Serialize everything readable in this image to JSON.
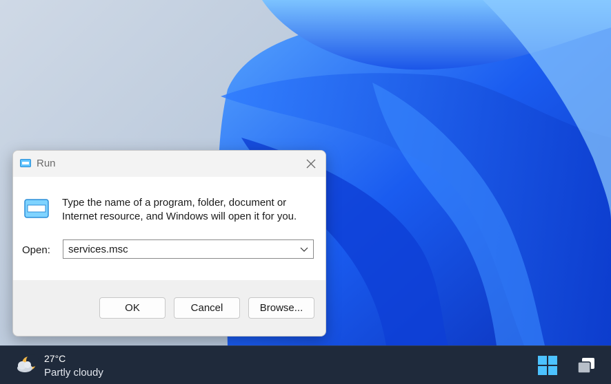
{
  "dialog": {
    "title": "Run",
    "instruction": "Type the name of a program, folder, document or Internet resource, and Windows will open it for you.",
    "open_label": "Open:",
    "open_value": "services.msc",
    "buttons": {
      "ok": "OK",
      "cancel": "Cancel",
      "browse": "Browse..."
    }
  },
  "taskbar": {
    "weather": {
      "temperature": "27°C",
      "condition": "Partly cloudy",
      "icon": "partly-cloudy-moon-icon"
    },
    "icons": {
      "start": "windows-logo-icon",
      "task_view": "task-view-icon"
    }
  },
  "colors": {
    "accent_blue": "#1f6bff",
    "taskbar_bg": "#1f2a3b",
    "dialog_bg": "#f0f0f0",
    "content_bg": "#ffffff"
  }
}
